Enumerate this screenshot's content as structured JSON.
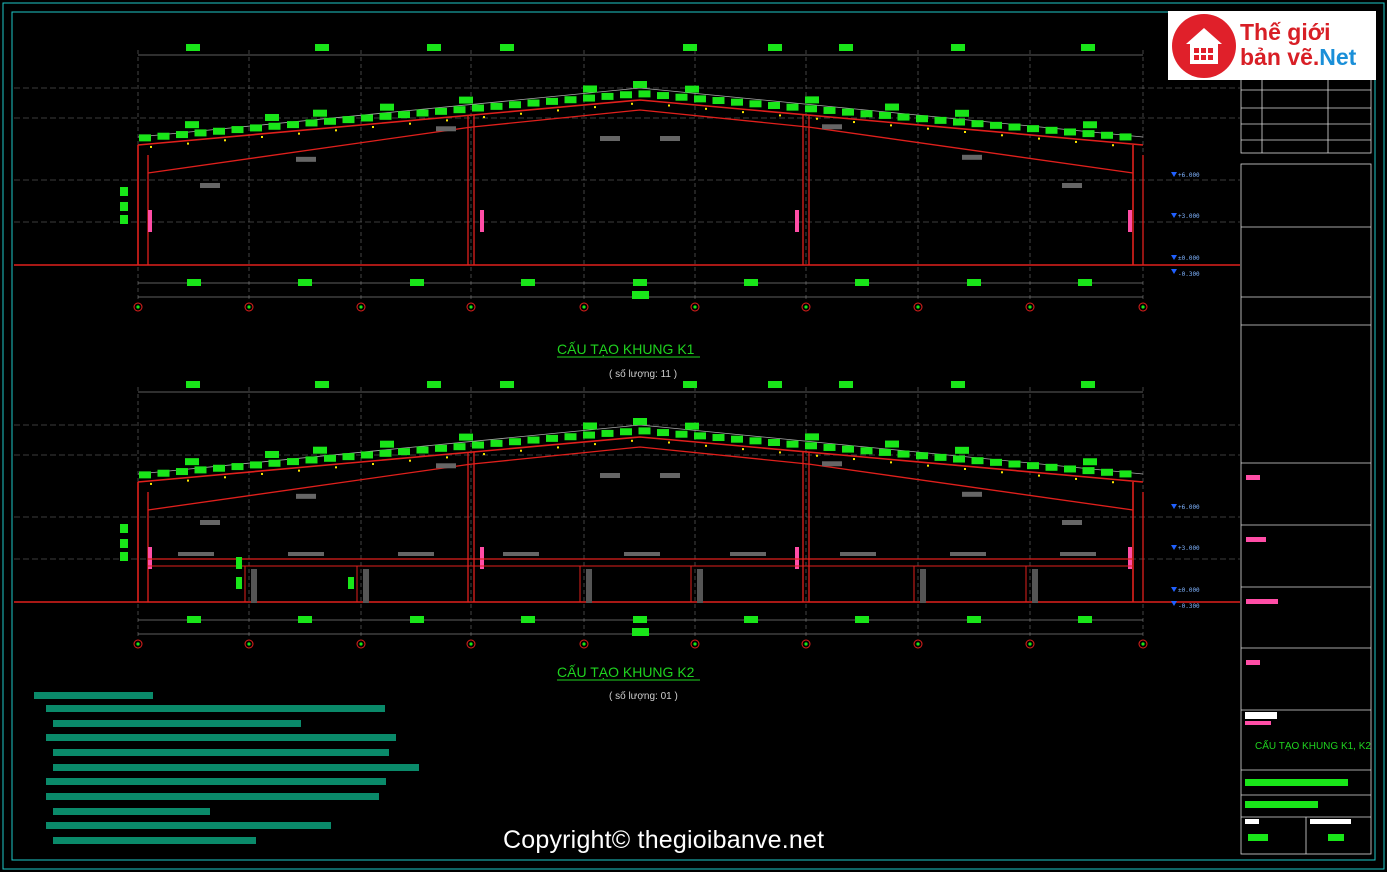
{
  "frames": [
    {
      "id": "k1",
      "title": "CẤU TẠO KHUNG K1",
      "subtitle": "( số lượng: 11 )"
    },
    {
      "id": "k2",
      "title": "CẤU TẠO KHUNG K2",
      "subtitle": "( số lượng: 01 )"
    }
  ],
  "elevations": [
    "+6.000",
    "+3.000",
    "±0.000",
    "-0.300"
  ],
  "title_block": {
    "drawing_title": "CẤU TẠO KHUNG K1, K2"
  },
  "watermark": {
    "copyright": "Copyright© thegioibanve.net",
    "logo_line1": "Thế giới",
    "logo_line2a": "bản vẽ.",
    "logo_line2b": "Net"
  },
  "colors": {
    "frame": "#e0201c",
    "dimension_tag": "#19e619",
    "notes": "#0a8a6a",
    "border": "#1ec8c8",
    "grid": "#b0b0b0"
  }
}
